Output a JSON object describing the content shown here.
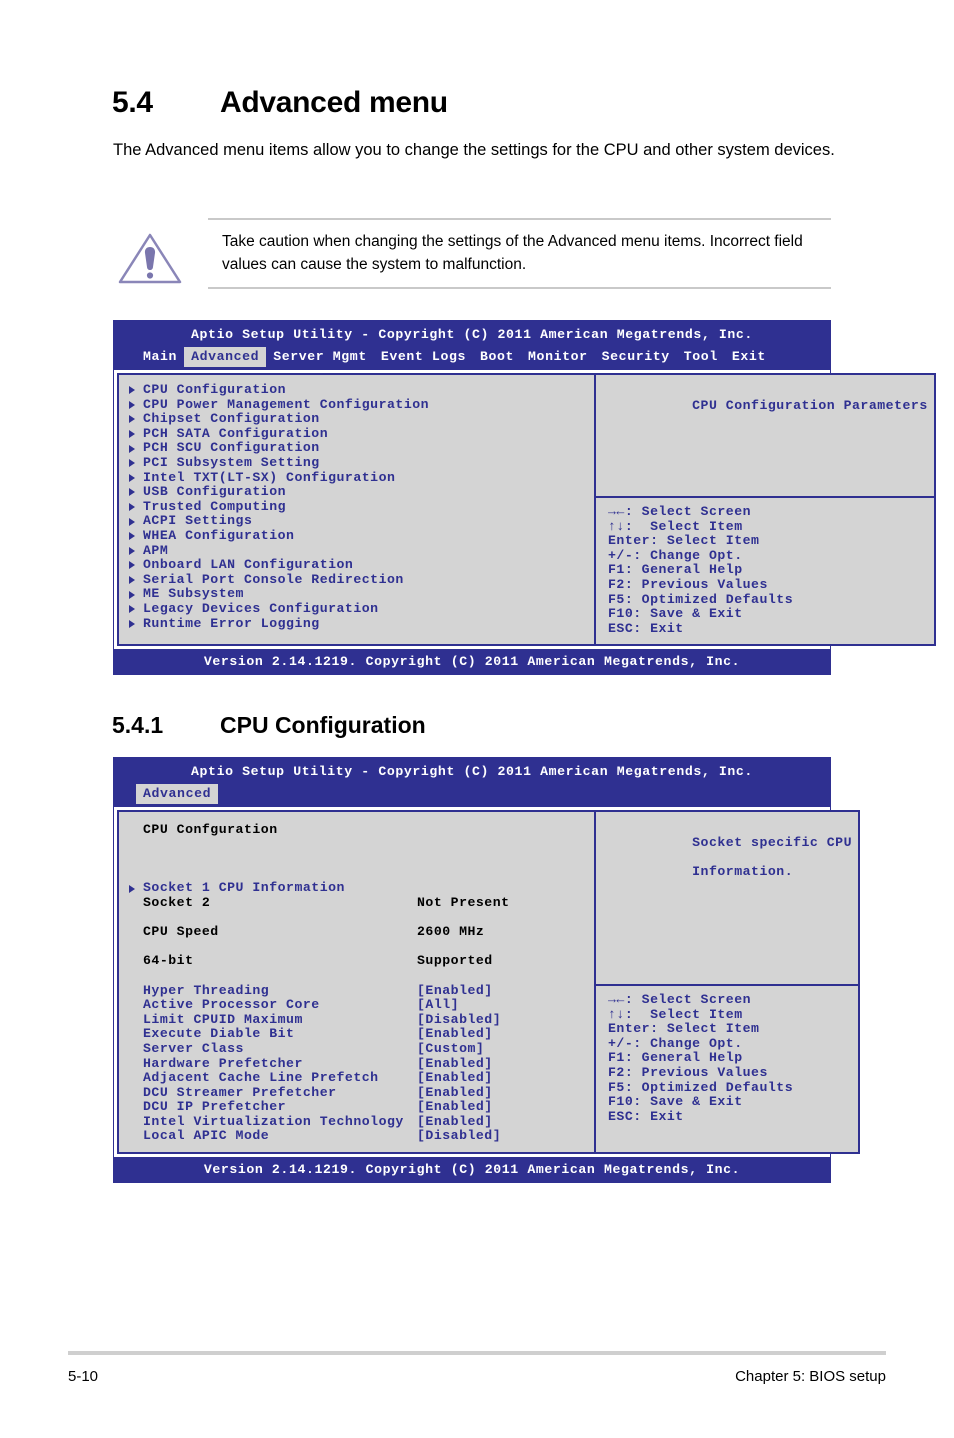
{
  "document": {
    "section_number": "5.4",
    "section_title": "Advanced menu",
    "intro": "The Advanced menu items allow you to change the settings for the CPU and other system devices.",
    "caution": "Take caution when changing the settings of the Advanced menu items. Incorrect field values can cause the system to malfunction.",
    "subsection_number": "5.4.1",
    "subsection_title": "CPU Configuration",
    "footer_page": "5-10",
    "footer_chapter": "Chapter 5: BIOS setup",
    "caution_icon": "warning-triangle-icon"
  },
  "colors": {
    "bios_blue": "#2f3091",
    "bios_panel_gray": "#d4d4d4",
    "note_icon_purple": "#8a86b8"
  },
  "bios_advanced": {
    "title": "Aptio Setup Utility - Copyright (C) 2011 American Megatrends, Inc.",
    "tabs": [
      {
        "label": "Main",
        "active": false
      },
      {
        "label": "Advanced",
        "active": true
      },
      {
        "label": "Server Mgmt",
        "active": false
      },
      {
        "label": "Event Logs",
        "active": false
      },
      {
        "label": "Boot",
        "active": false
      },
      {
        "label": "Monitor",
        "active": false
      },
      {
        "label": "Security",
        "active": false
      },
      {
        "label": "Tool",
        "active": false
      },
      {
        "label": "Exit",
        "active": false
      }
    ],
    "menu_items": [
      "CPU Configuration",
      "CPU Power Management Configuration",
      "Chipset Configuration",
      "PCH SATA Configuration",
      "PCH SCU Configuration",
      "PCI Subsystem Setting",
      "Intel TXT(LT-SX) Configuration",
      "USB Configuration",
      "Trusted Computing",
      "ACPI Settings",
      "WHEA Configuration",
      "APM",
      "Onboard LAN Configuration",
      "Serial Port Console Redirection",
      "ME Subsystem",
      "Legacy Devices Configuration",
      "Runtime Error Logging"
    ],
    "help_text": "CPU Configuration Parameters",
    "help_keys": [
      "→←: Select Screen",
      "↑↓:  Select Item",
      "Enter: Select Item",
      "+/-: Change Opt.",
      "F1: General Help",
      "F2: Previous Values",
      "F5: Optimized Defaults",
      "F10: Save & Exit",
      "ESC: Exit"
    ],
    "version": "Version 2.14.1219. Copyright (C) 2011 American Megatrends, Inc."
  },
  "bios_cpu": {
    "title": "Aptio Setup Utility - Copyright (C) 2011 American Megatrends, Inc.",
    "tabs": [
      {
        "label": "Advanced",
        "active": true
      }
    ],
    "heading": "CPU Confguration",
    "submenu": "Socket 1 CPU Information",
    "info_rows": [
      {
        "label": "Socket 2",
        "value": "Not Present"
      },
      {
        "label": "CPU Speed",
        "value": "2600 MHz"
      },
      {
        "label": "64-bit",
        "value": "Supported"
      }
    ],
    "setting_rows": [
      {
        "label": "Hyper Threading",
        "value": "[Enabled]"
      },
      {
        "label": "Active Processor Core",
        "value": "[All]"
      },
      {
        "label": "Limit CPUID Maximum",
        "value": "[Disabled]"
      },
      {
        "label": "Execute Diable Bit",
        "value": "[Enabled]"
      },
      {
        "label": "Server Class",
        "value": "[Custom]"
      },
      {
        "label": "Hardware Prefetcher",
        "value": "[Enabled]"
      },
      {
        "label": "Adjacent Cache Line Prefetch",
        "value": "[Enabled]"
      },
      {
        "label": "DCU Streamer Prefetcher",
        "value": "[Enabled]"
      },
      {
        "label": "DCU IP Prefetcher",
        "value": "[Enabled]"
      },
      {
        "label": "Intel Virtualization Technology",
        "value": "[Enabled]"
      },
      {
        "label": "Local APIC Mode",
        "value": "[Disabled]"
      }
    ],
    "help_text_line1": "Socket specific CPU",
    "help_text_line2": "Information.",
    "help_keys": [
      "→←: Select Screen",
      "↑↓:  Select Item",
      "Enter: Select Item",
      "+/-: Change Opt.",
      "F1: General Help",
      "F2: Previous Values",
      "F5: Optimized Defaults",
      "F10: Save & Exit",
      "ESC: Exit"
    ],
    "version": "Version 2.14.1219. Copyright (C) 2011 American Megatrends, Inc."
  }
}
